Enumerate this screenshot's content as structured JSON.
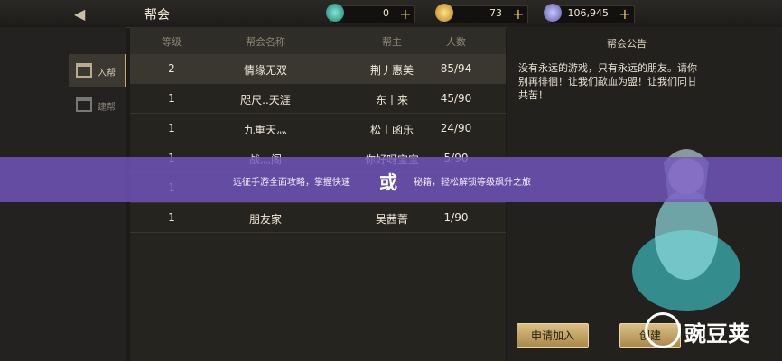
{
  "header": {
    "title": "帮会",
    "resources": [
      {
        "icon": "jade-icon",
        "value": "0"
      },
      {
        "icon": "gold-ingot-icon",
        "value": "73"
      },
      {
        "icon": "silver-coin-icon",
        "value": "106,945"
      }
    ]
  },
  "sidebar": {
    "tabs": [
      {
        "label": "入帮",
        "icon": "gate-icon"
      },
      {
        "label": "建帮",
        "icon": "build-icon"
      }
    ]
  },
  "table": {
    "columns": [
      "等级",
      "帮会名称",
      "帮主",
      "人数"
    ],
    "rows": [
      {
        "level": "2",
        "name": "情缘无双",
        "leader": "荆丿惠美",
        "members": "85/94"
      },
      {
        "level": "1",
        "name": "咫尺..天涯",
        "leader": "东丨来",
        "members": "45/90"
      },
      {
        "level": "1",
        "name": "九重天灬",
        "leader": "松丨函乐",
        "members": "24/90"
      },
      {
        "level": "1",
        "name": "战灬阁",
        "leader": "你好呀宝宝",
        "members": "5/90"
      },
      {
        "level": "1",
        "name": "",
        "leader": "",
        "members": ""
      },
      {
        "level": "1",
        "name": "朋友家",
        "leader": "吴茜菁",
        "members": "1/90"
      }
    ]
  },
  "notice": {
    "title": "帮会公告",
    "text": "没有永远的游戏，只有永远的朋友。请你别再徘徊！让我们歃血为盟！让我们同甘共苦！"
  },
  "buttons": {
    "apply": "申请加入",
    "create": "创建"
  },
  "banner": {
    "text": "远征手游全面攻略，掌握快速",
    "text2": "秘籍，轻松解锁等级飙升之旅",
    "big": "或"
  },
  "watermark": {
    "text": "豌豆荚"
  }
}
